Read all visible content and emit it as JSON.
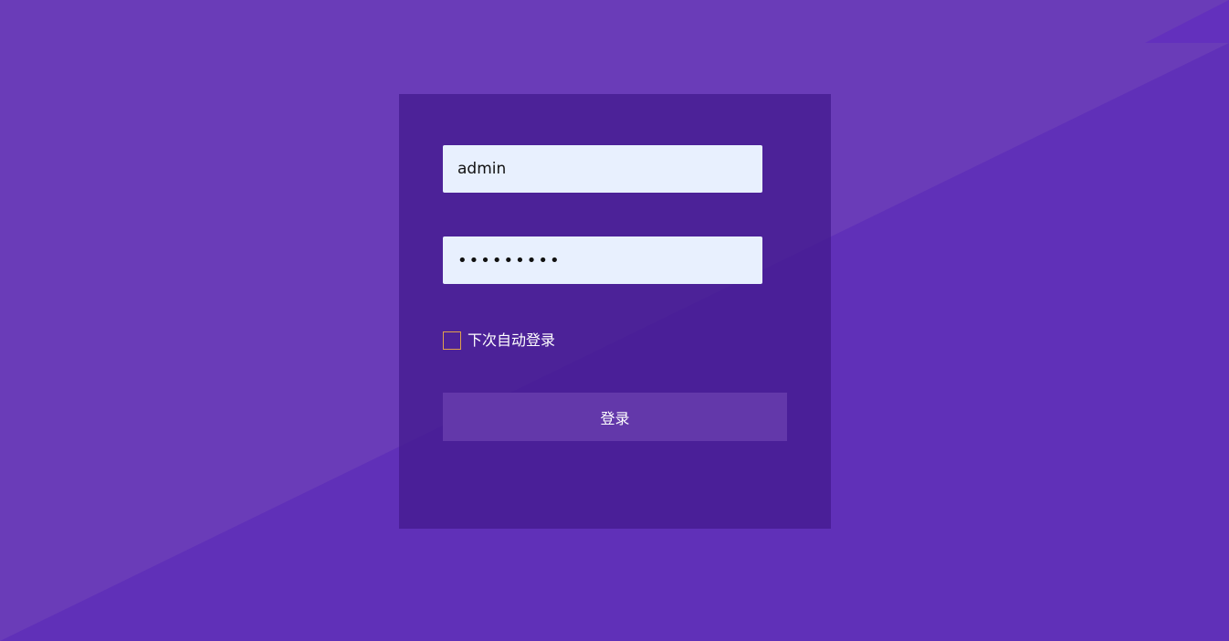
{
  "login_form": {
    "username_value": "admin",
    "password_value": "•••••••••",
    "remember_label": "下次自动登录",
    "remember_checked": false,
    "submit_label": "登录"
  },
  "colors": {
    "background_upper": "#673ab7",
    "background_lower": "#6030b8",
    "panel": "#4b1f91",
    "input_background": "#e8f0fe",
    "checkbox_border": "#e0a04c",
    "button": "#6338aa",
    "text_light": "#ffffff"
  }
}
